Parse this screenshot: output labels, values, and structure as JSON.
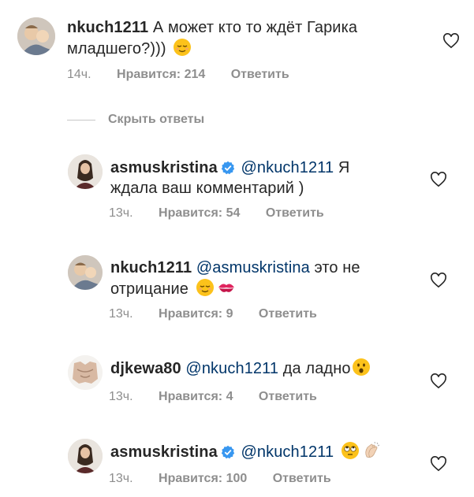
{
  "comments": [
    {
      "username": "nkuch1211",
      "text": "А может кто то ждёт Гарика младшего?)))",
      "emoji": "relieved-face",
      "time": "14ч.",
      "likes": "Нравится: 214",
      "reply": "Ответить"
    },
    {
      "username": "asmuskristina",
      "verified": true,
      "mention": "@nkuch1211",
      "text": "Я ждала ваш комментарий )",
      "time": "13ч.",
      "likes": "Нравится: 54",
      "reply": "Ответить"
    },
    {
      "username": "nkuch1211",
      "mention": "@asmuskristina",
      "text": "это не отрицание",
      "emoji": "relieved-face, kiss-mark",
      "time": "13ч.",
      "likes": "Нравится: 9",
      "reply": "Ответить"
    },
    {
      "username": "djkewa80",
      "mention": "@nkuch1211",
      "text": "да ладно",
      "emoji": "hushed-face",
      "time": "13ч.",
      "likes": "Нравится: 4",
      "reply": "Ответить"
    },
    {
      "username": "asmuskristina",
      "verified": true,
      "mention": "@nkuch1211",
      "emoji": "rolling-eyes-face, clapping-hands",
      "time": "13ч.",
      "likes": "Нравится: 100",
      "reply": "Ответить"
    }
  ],
  "hide_replies": "Скрыть ответы",
  "colors": {
    "text": "#262626",
    "meta": "#8e8e8e",
    "mention": "#003569",
    "verified": "#3897f0"
  }
}
